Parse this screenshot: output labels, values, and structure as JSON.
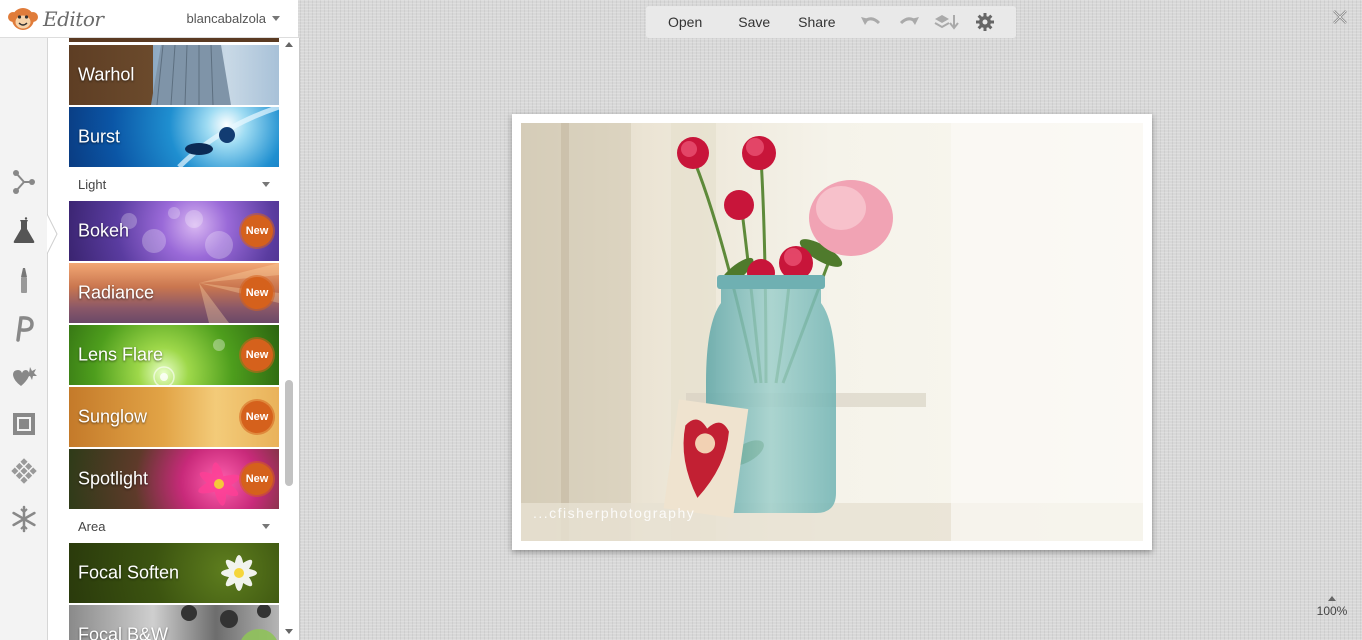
{
  "app": {
    "title": "Editor",
    "username": "blancabalzola"
  },
  "toolbar": {
    "open_label": "Open",
    "save_label": "Save",
    "share_label": "Share"
  },
  "effects": {
    "tiles_top": [
      {
        "label": "Warhol"
      },
      {
        "label": "Burst"
      }
    ],
    "light_section": {
      "label": "Light",
      "items": [
        {
          "label": "Bokeh",
          "badge": "New"
        },
        {
          "label": "Radiance",
          "badge": "New"
        },
        {
          "label": "Lens Flare",
          "badge": "New"
        },
        {
          "label": "Sunglow",
          "badge": "New"
        },
        {
          "label": "Spotlight",
          "badge": "New"
        }
      ]
    },
    "area_section": {
      "label": "Area",
      "items": [
        {
          "label": "Focal Soften"
        },
        {
          "label": "Focal B&W"
        }
      ]
    }
  },
  "canvas": {
    "watermark": "...cfisherphotography",
    "zoom": "100%"
  },
  "colors": {
    "badge": "#d5611c",
    "rail_background": "#f3f3f3",
    "toolbar_background": "#e9e9e9"
  },
  "icons": [
    "monkey-logo-icon",
    "crop-basic-edits-icon",
    "effects-flask-icon",
    "touch-up-brush-icon",
    "text-icon",
    "stickers-icon",
    "frames-icon",
    "textures-icon",
    "overlays-snowflake-icon",
    "undo-icon",
    "redo-icon",
    "layers-icon",
    "settings-gear-icon",
    "close-icon"
  ]
}
